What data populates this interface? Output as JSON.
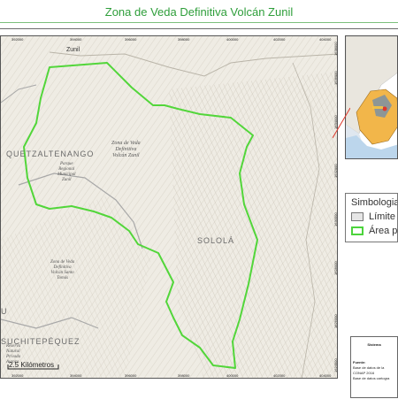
{
  "title": "Zona de Veda Definitiva Volcán Zunil",
  "map": {
    "x_ticks": [
      "392000",
      "394000",
      "396000",
      "398000",
      "400000",
      "402000",
      "404000"
    ],
    "y_ticks": [
      "1624000",
      "1626000",
      "1628000",
      "1630000",
      "1632000",
      "1634000",
      "1636000",
      "1638000"
    ],
    "labels": {
      "zunil": "Zunil",
      "quetzaltenango": "QUETZALTENANGO",
      "solola": "SOLOLÁ",
      "suchitepequez": "SUCHITEPÉQUEZ",
      "zona_volcan_zunil": [
        "Zona de Veda",
        "Definitiva",
        "Volcán Zunil"
      ],
      "parque_regional": [
        "Parque",
        "Regional",
        "Municipal",
        "Zunil"
      ],
      "zona_santo_tomas": [
        "Zona de Veda",
        "Definitiva",
        "Volcán Santo",
        "Tomás"
      ],
      "reserva": [
        "Reserva",
        "Natural",
        "Privada",
        "Aurora"
      ],
      "left_fragment": "U"
    },
    "scale_label": "2.5 Kilómetros"
  },
  "legend": {
    "title": "Simbologia",
    "items": [
      {
        "label": "Límite",
        "fill": "#e6e6e6",
        "stroke": "#777777"
      },
      {
        "label": "Área pr",
        "fill": "#ffffff",
        "stroke": "#4cd43c"
      }
    ]
  },
  "info": {
    "heading": "Sistema",
    "lines": [
      "Fuente:",
      "Base de datos de la",
      "CONAP 2016",
      "Base de datos cartogra"
    ]
  },
  "colors": {
    "title": "#2e9e3a",
    "boundary": "#52d63a",
    "terrain": "#efece4"
  }
}
